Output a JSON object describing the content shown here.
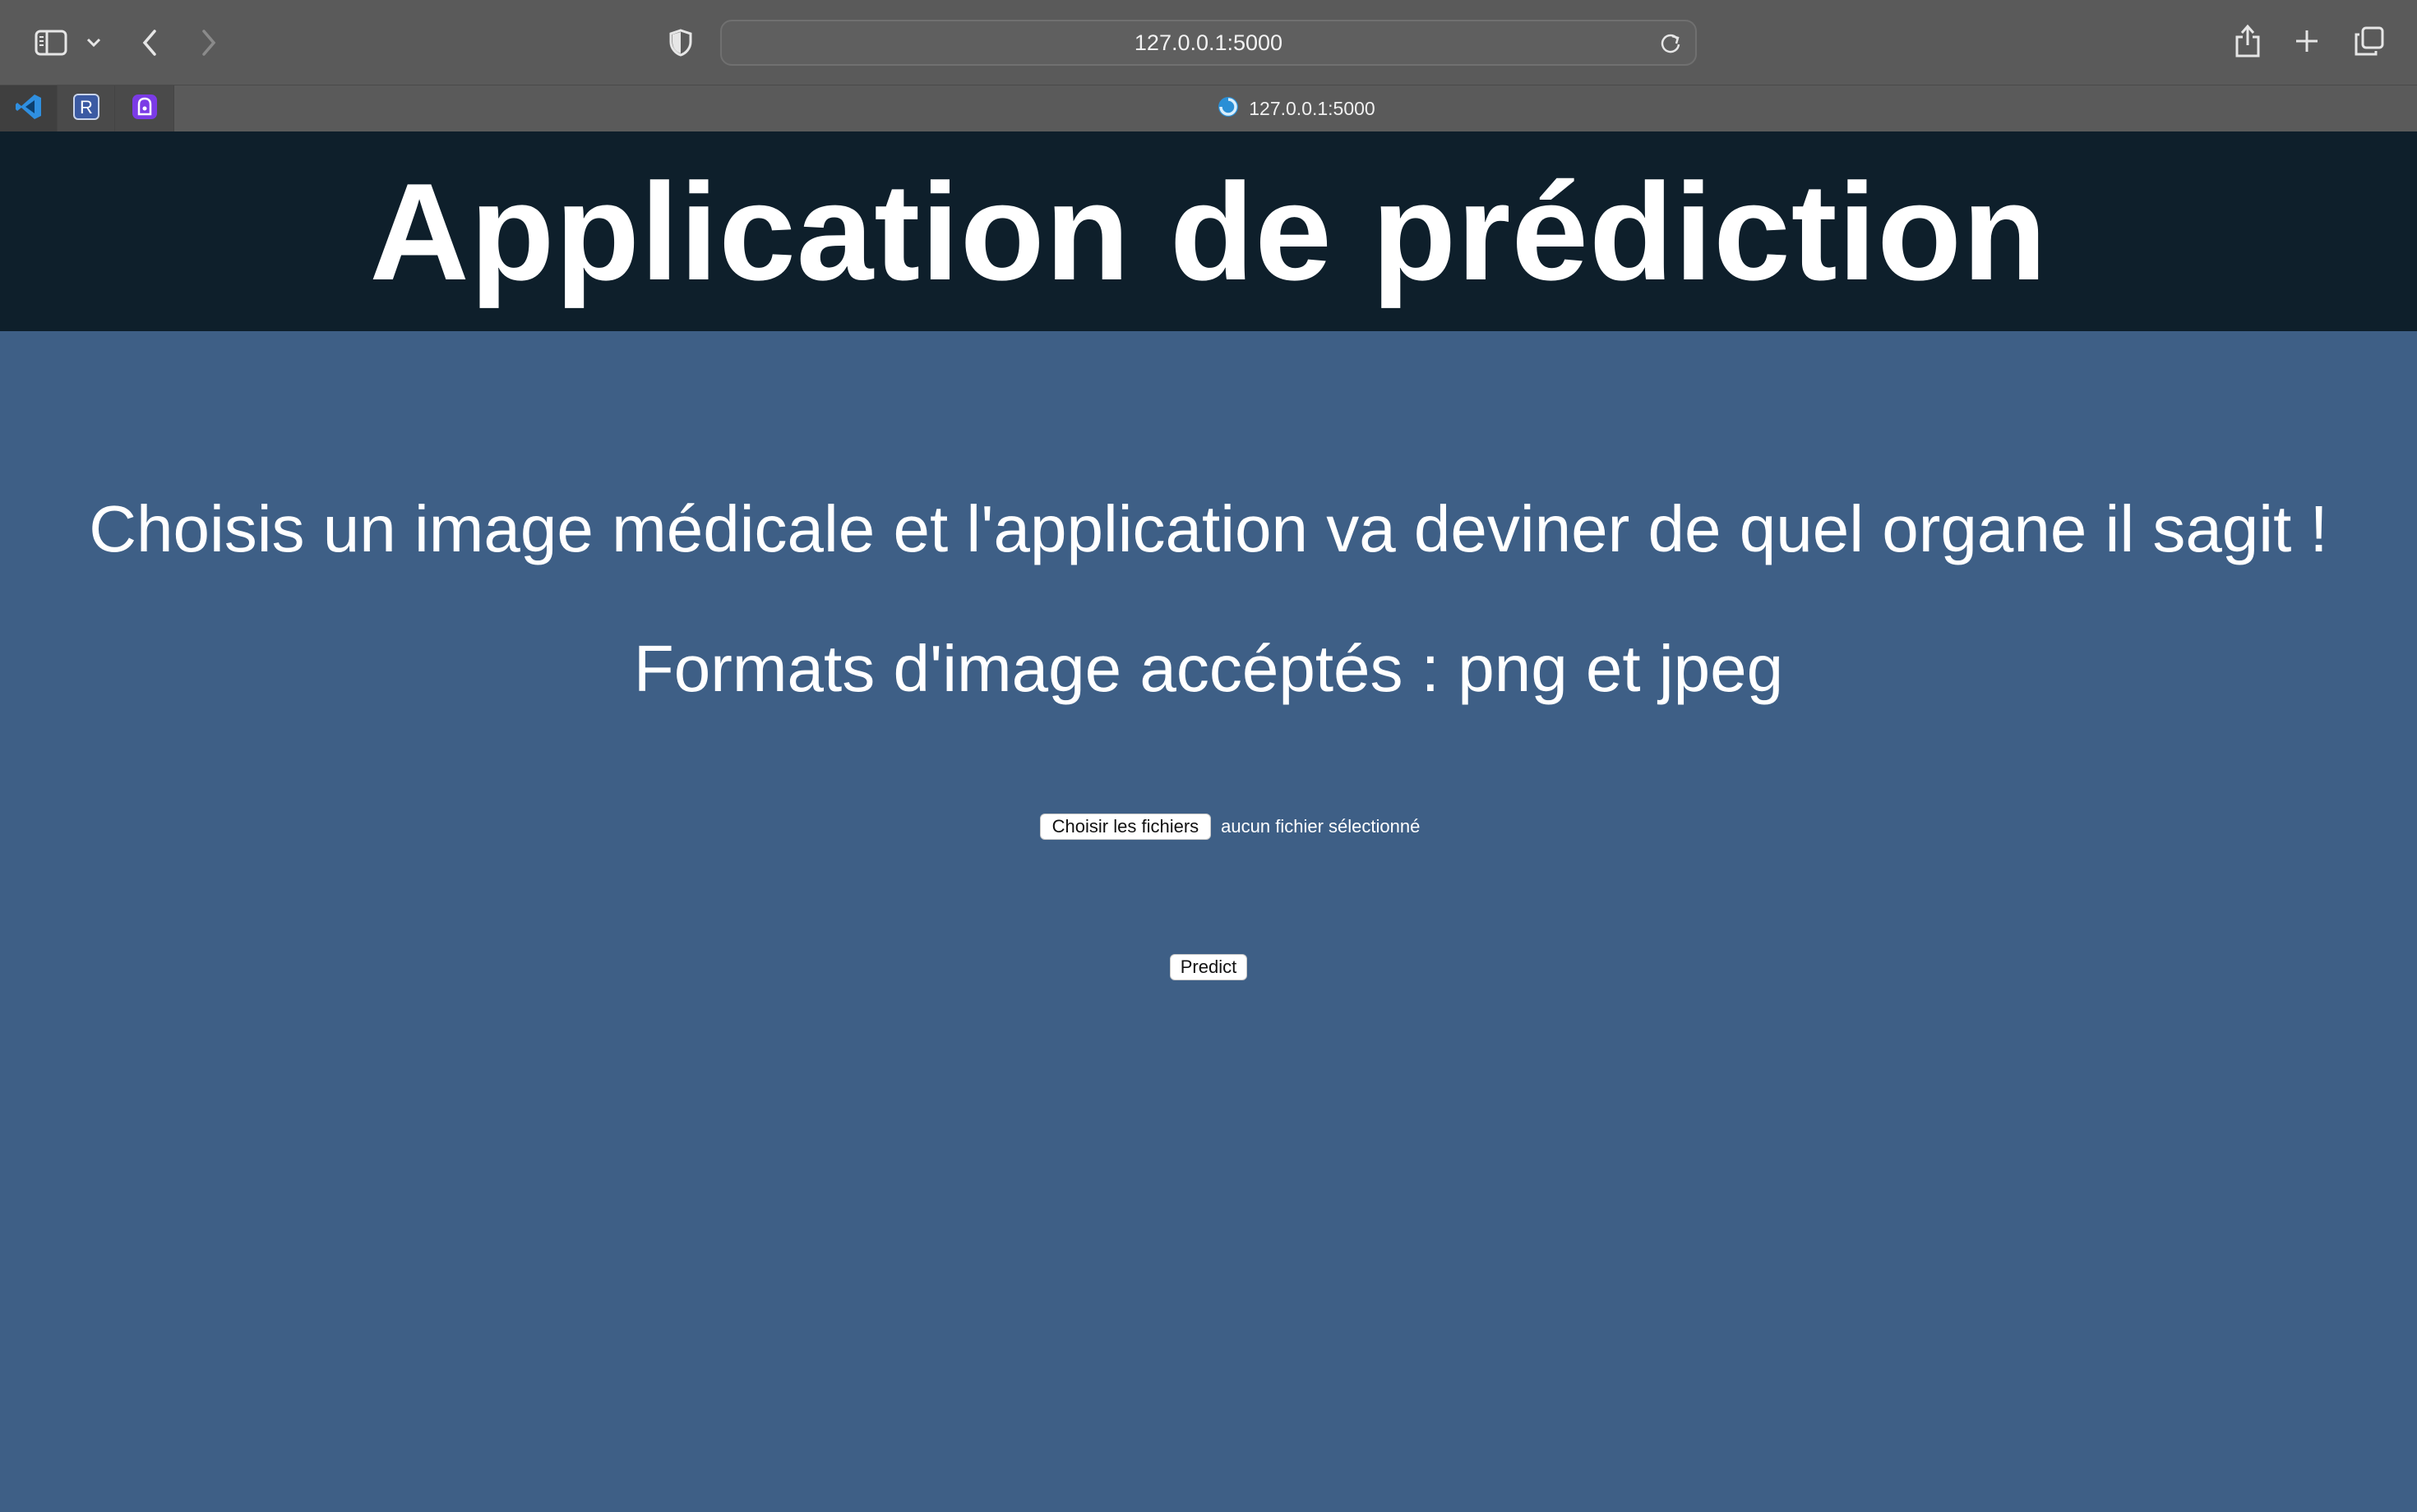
{
  "browser": {
    "url": "127.0.0.1:5000",
    "active_tab_title": "127.0.0.1:5000",
    "pinned_tabs": [
      {
        "icon": "vscode-icon"
      },
      {
        "icon": "r-icon",
        "letter": "R"
      },
      {
        "icon": "proton-vpn-icon"
      }
    ],
    "toolbar_icons": [
      "sidebar-icon",
      "chevron-down-icon",
      "back-icon",
      "forward-icon",
      "shield-icon",
      "reload-icon",
      "share-icon",
      "new-tab-icon",
      "tab-overview-icon"
    ]
  },
  "page": {
    "title": "Application de prédiction",
    "instruction": "Choisis un image médicale et l'application va deviner de quel organe il sagit !",
    "formats": "Formats d'image accéptés : png et jpeg",
    "file_button_label": "Choisir les fichiers",
    "file_status": "aucun fichier sélectionné",
    "predict_label": "Predict"
  },
  "colors": {
    "header_bg": "#0e1f2b",
    "body_bg": "#3e5f86",
    "toolbar_bg": "#5a5a5a"
  }
}
